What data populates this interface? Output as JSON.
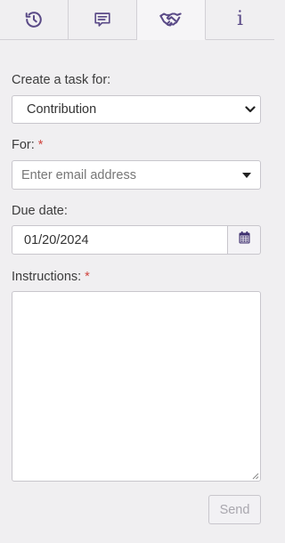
{
  "tabs": [
    {
      "icon": "history-icon",
      "active": false
    },
    {
      "icon": "comment-icon",
      "active": false
    },
    {
      "icon": "handshake-icon",
      "active": true
    },
    {
      "icon": "info-icon",
      "glyph": "i",
      "active": false
    }
  ],
  "colors": {
    "accent": "#5a4a87",
    "required": "#d0453f",
    "background": "#f0eff1"
  },
  "form": {
    "task_for_label": "Create a task for:",
    "task_for_value": "Contribution",
    "for_label": "For:",
    "required_mark": "*",
    "email_placeholder": "Enter email address",
    "due_date_label": "Due date:",
    "due_date_value": "01/20/2024",
    "instructions_label": "Instructions:",
    "instructions_value": "",
    "send_label": "Send"
  }
}
